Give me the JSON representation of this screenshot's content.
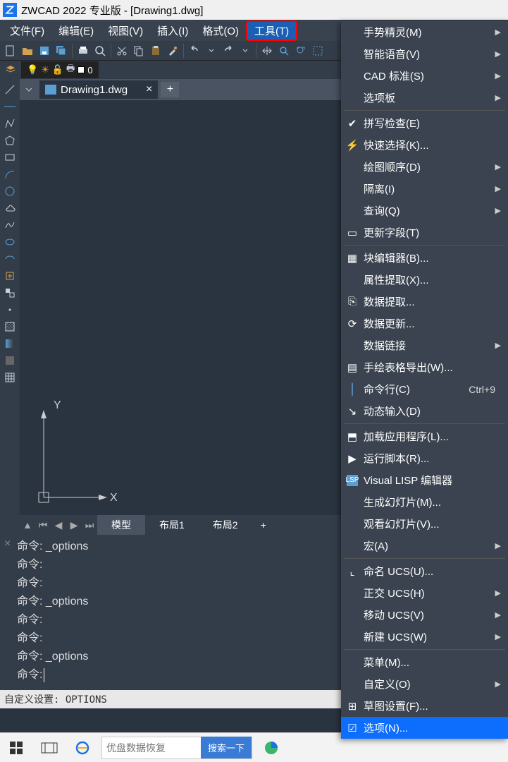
{
  "title": "ZWCAD 2022 专业版 - [Drawing1.dwg]",
  "menu": {
    "file": "文件(F)",
    "edit": "编辑(E)",
    "view": "视图(V)",
    "insert": "插入(I)",
    "format": "格式(O)",
    "tools": "工具(T)"
  },
  "layer": {
    "name": "0"
  },
  "doc_tab": {
    "name": "Drawing1.dwg"
  },
  "axis": {
    "x": "X",
    "y": "Y"
  },
  "layout_tabs": {
    "model": "模型",
    "layout1": "布局1",
    "layout2": "布局2",
    "add": "+"
  },
  "cmd": {
    "l1": "命令: _options",
    "l2": "命令:",
    "l3": "命令:",
    "l4": "命令: _options",
    "l5": "命令:",
    "l6": "命令:",
    "l7": "命令: _options",
    "prompt": "命令:"
  },
  "status": "自定义设置: OPTIONS",
  "taskbar": {
    "search_placeholder": "优盘数据恢复",
    "search_btn": "搜索一下"
  },
  "dropdown": {
    "gesture": "手势精灵(M)",
    "voice": "智能语音(V)",
    "cadstd": "CAD 标准(S)",
    "palettes": "选项板",
    "spell": "拼写检查(E)",
    "qselect": "快速选择(K)...",
    "draworder": "绘图顺序(D)",
    "isolate": "隔离(I)",
    "query": "查询(Q)",
    "updfield": "更新字段(T)",
    "bedit": "块编辑器(B)...",
    "attext": "属性提取(X)...",
    "dataext": "数据提取...",
    "dataupd": "数据更新...",
    "datalink": "数据链接",
    "handtbl": "手绘表格导出(W)...",
    "cmdline": "命令行(C)",
    "cmdline_sc": "Ctrl+9",
    "dyninput": "动态输入(D)",
    "apload": "加载应用程序(L)...",
    "script": "运行脚本(R)...",
    "vlisp": "Visual LISP 编辑器",
    "mslide": "生成幻灯片(M)...",
    "vslide": "观看幻灯片(V)...",
    "macro": "宏(A)",
    "nucs": "命名 UCS(U)...",
    "oucs": "正交 UCS(H)",
    "mucs": "移动 UCS(V)",
    "newucs": "新建 UCS(W)",
    "menu_": "菜单(M)...",
    "custom": "自定义(O)",
    "dsettings": "草图设置(F)...",
    "options": "选项(N)..."
  }
}
